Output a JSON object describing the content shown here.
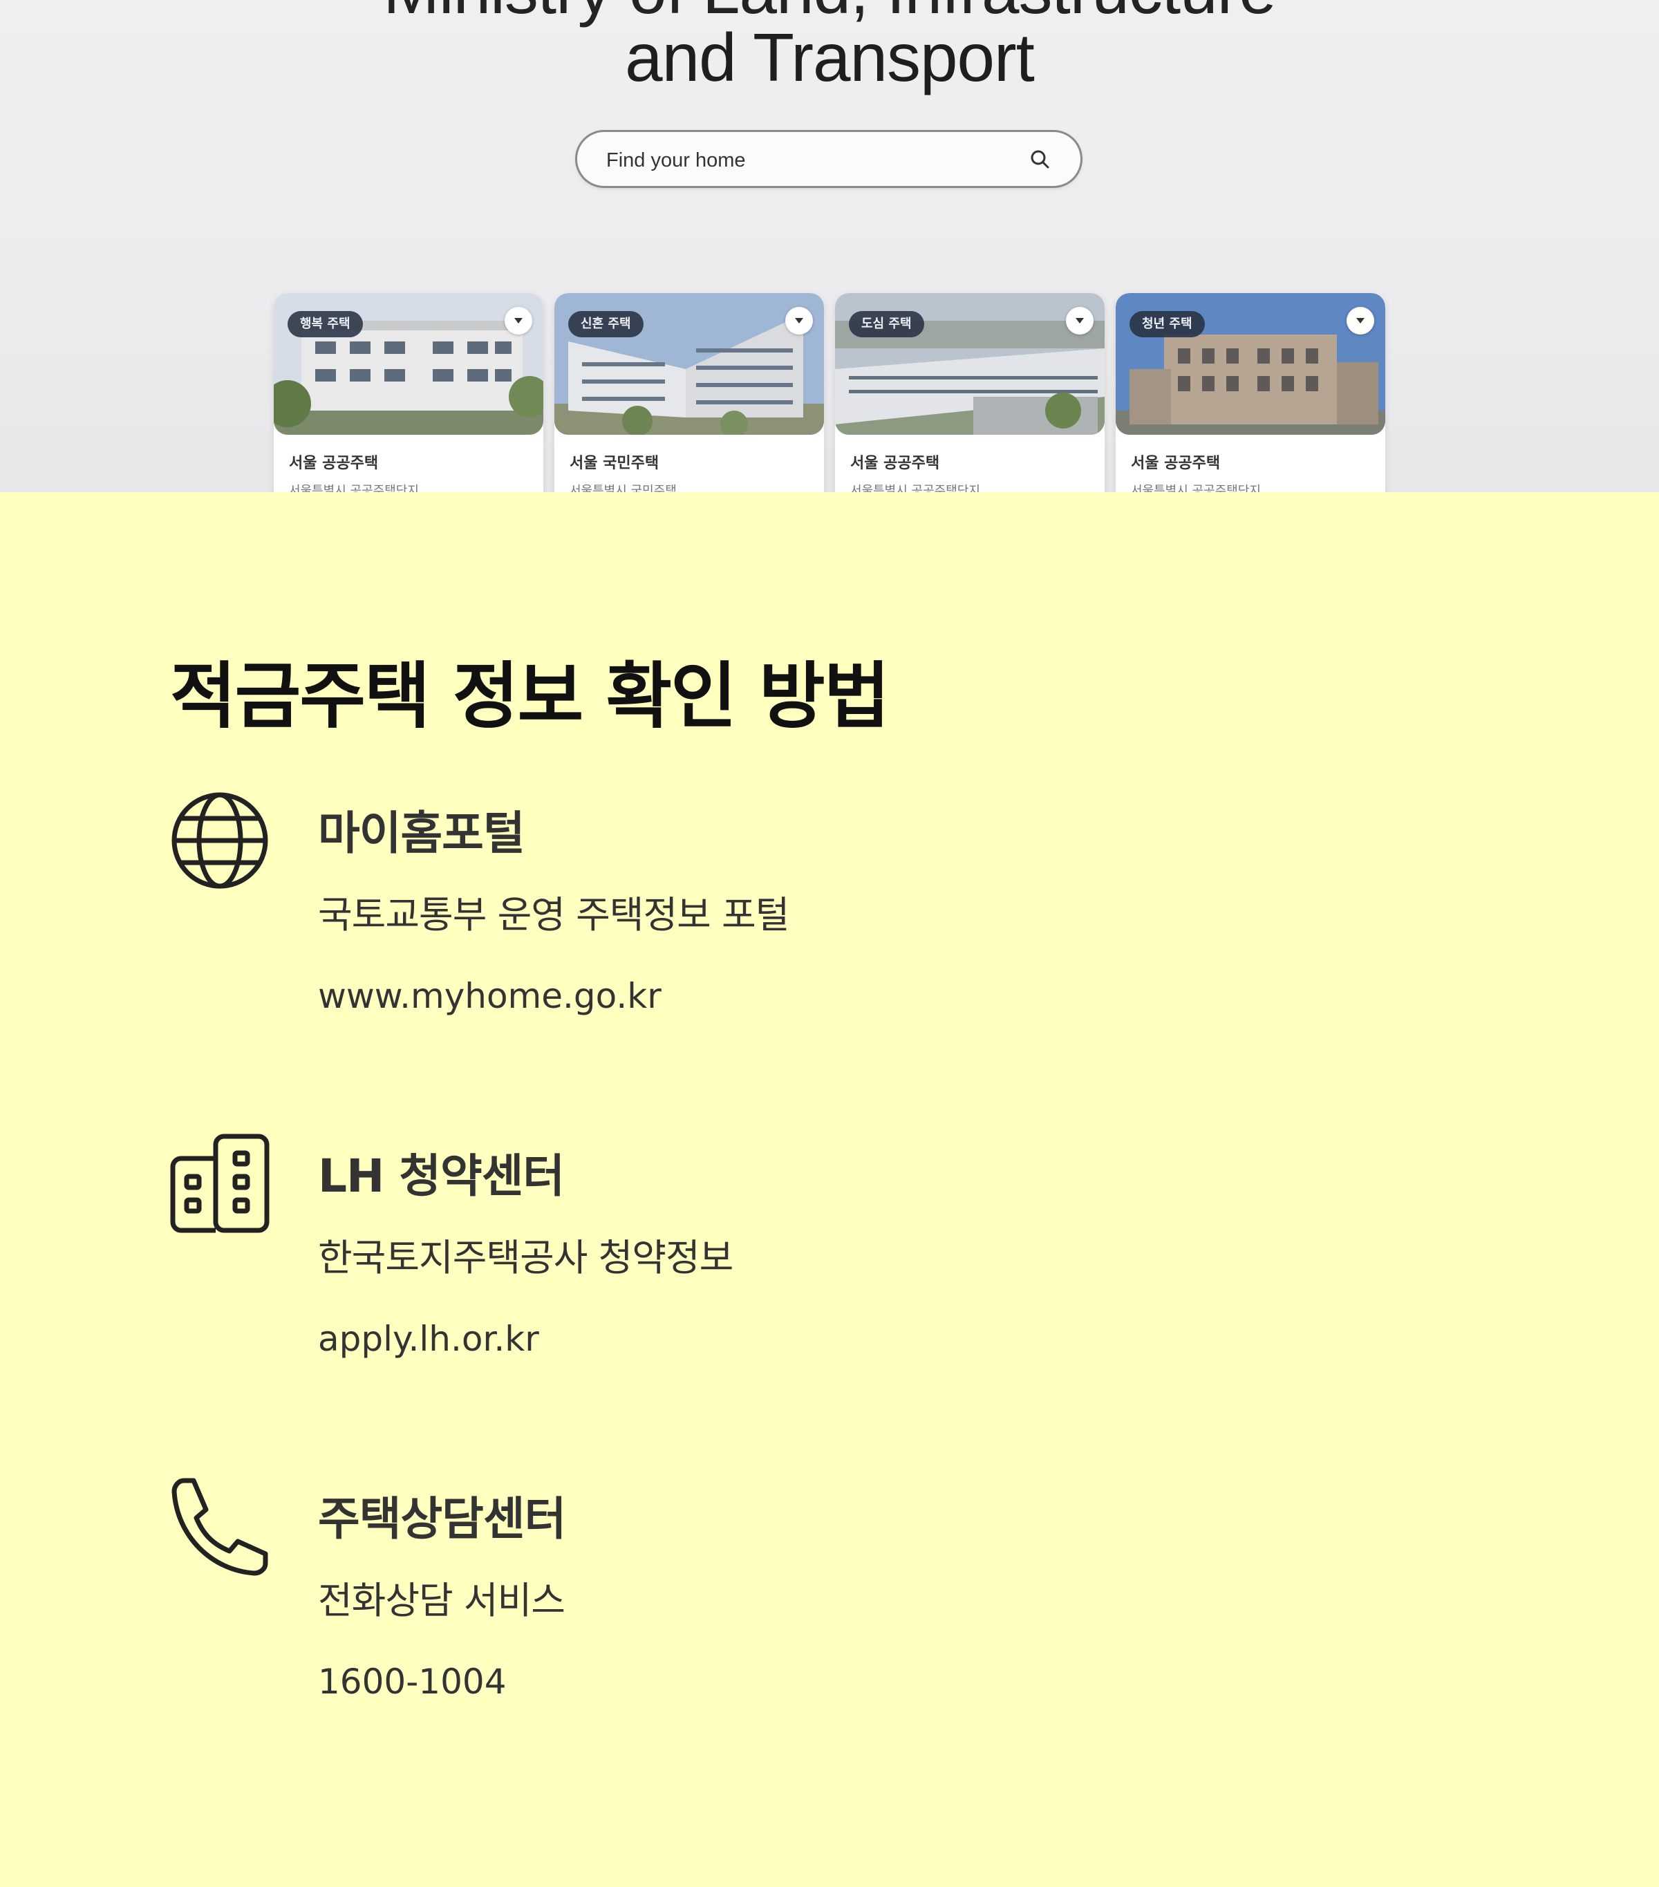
{
  "hero": {
    "title_line1": "Ministry of Land, Infrastructure",
    "title_line2": "and Transport",
    "search_placeholder": "Find your home"
  },
  "cards": [
    {
      "tag": "행복 주택",
      "name": "서울 공공주택",
      "address": "서울특별시 공공주택단지"
    },
    {
      "tag": "신혼 주택",
      "name": "서울 국민주택",
      "address": "서울특별시 국민주택"
    },
    {
      "tag": "도심 주택",
      "name": "서울 공공주택",
      "address": "서울특별시 공공주택단지"
    },
    {
      "tag": "청년 주택",
      "name": "서울 공공주택",
      "address": "서울특별시 공공주택단지"
    }
  ],
  "section": {
    "title": "적금주택 정보 확인 방법",
    "items": [
      {
        "icon": "globe-icon",
        "name": "마이홈포털",
        "desc": "국토교통부 운영 주택정보 포털",
        "link": "www.myhome.go.kr"
      },
      {
        "icon": "building-icon",
        "name": "LH 청약센터",
        "desc": "한국토지주택공사 청약정보",
        "link": "apply.lh.or.kr"
      },
      {
        "icon": "phone-icon",
        "name": "주택상담센터",
        "desc": "전화상담 서비스",
        "link": "1600-1004"
      }
    ]
  },
  "colors": {
    "section_background": "#ffffc0",
    "hero_background": "#ececee",
    "text": "#333333",
    "title": "#111111"
  }
}
